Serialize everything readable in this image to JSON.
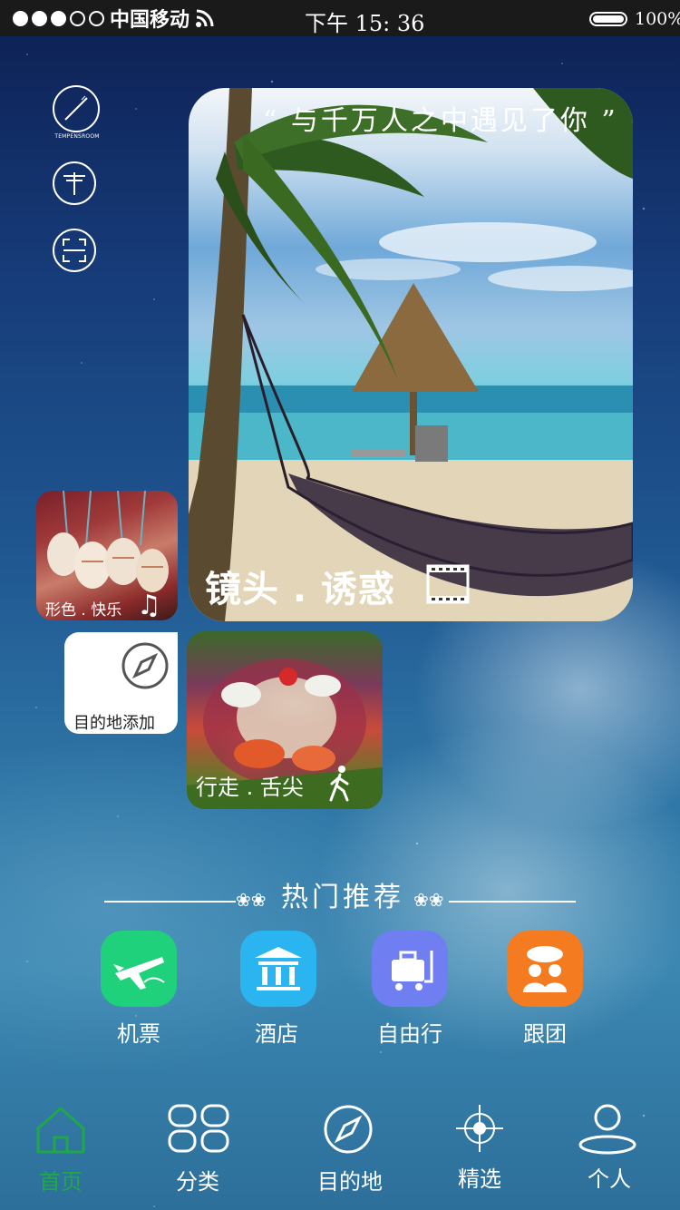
{
  "status_bar": {
    "carrier": "中国移动",
    "time": "下午 15: 36",
    "battery": "100%",
    "signal_dots_filled": 3,
    "signal_dots_total": 5
  },
  "side_icons": [
    {
      "name": "tempensroom-logo",
      "brand_text": "TEMPENSROOM"
    },
    {
      "name": "parasol-icon"
    },
    {
      "name": "scan-icon"
    }
  ],
  "main_card": {
    "quote": "“ 与千万人之中遇见了你 ”",
    "caption": "镜头 . 诱惑",
    "icon": "film-strip-icon"
  },
  "shell_card": {
    "caption": "形色 . 快乐",
    "icon": "music-note-icon"
  },
  "destination_card": {
    "label": "目的地添加",
    "icon": "compass-icon"
  },
  "food_card": {
    "caption": "行走 . 舌尖",
    "icon": "walker-icon"
  },
  "recommend": {
    "title": "热门推荐",
    "items": [
      {
        "label": "机票",
        "icon": "airplane-icon",
        "color": "#1fd17a"
      },
      {
        "label": "酒店",
        "icon": "hotel-icon",
        "color": "#2ab4f0"
      },
      {
        "label": "自由行",
        "icon": "luggage-icon",
        "color": "#6f7ef0"
      },
      {
        "label": "跟团",
        "icon": "group-tour-icon",
        "color": "#f47b1f"
      }
    ]
  },
  "bottom_nav": {
    "active_color": "#1fa84a",
    "items": [
      {
        "label": "首页",
        "icon": "home-icon"
      },
      {
        "label": "分类",
        "icon": "category-grid-icon"
      },
      {
        "label": "目的地",
        "icon": "compass-icon"
      },
      {
        "label": "精选",
        "icon": "crosshair-icon"
      },
      {
        "label": "个人",
        "icon": "user-icon"
      }
    ]
  }
}
